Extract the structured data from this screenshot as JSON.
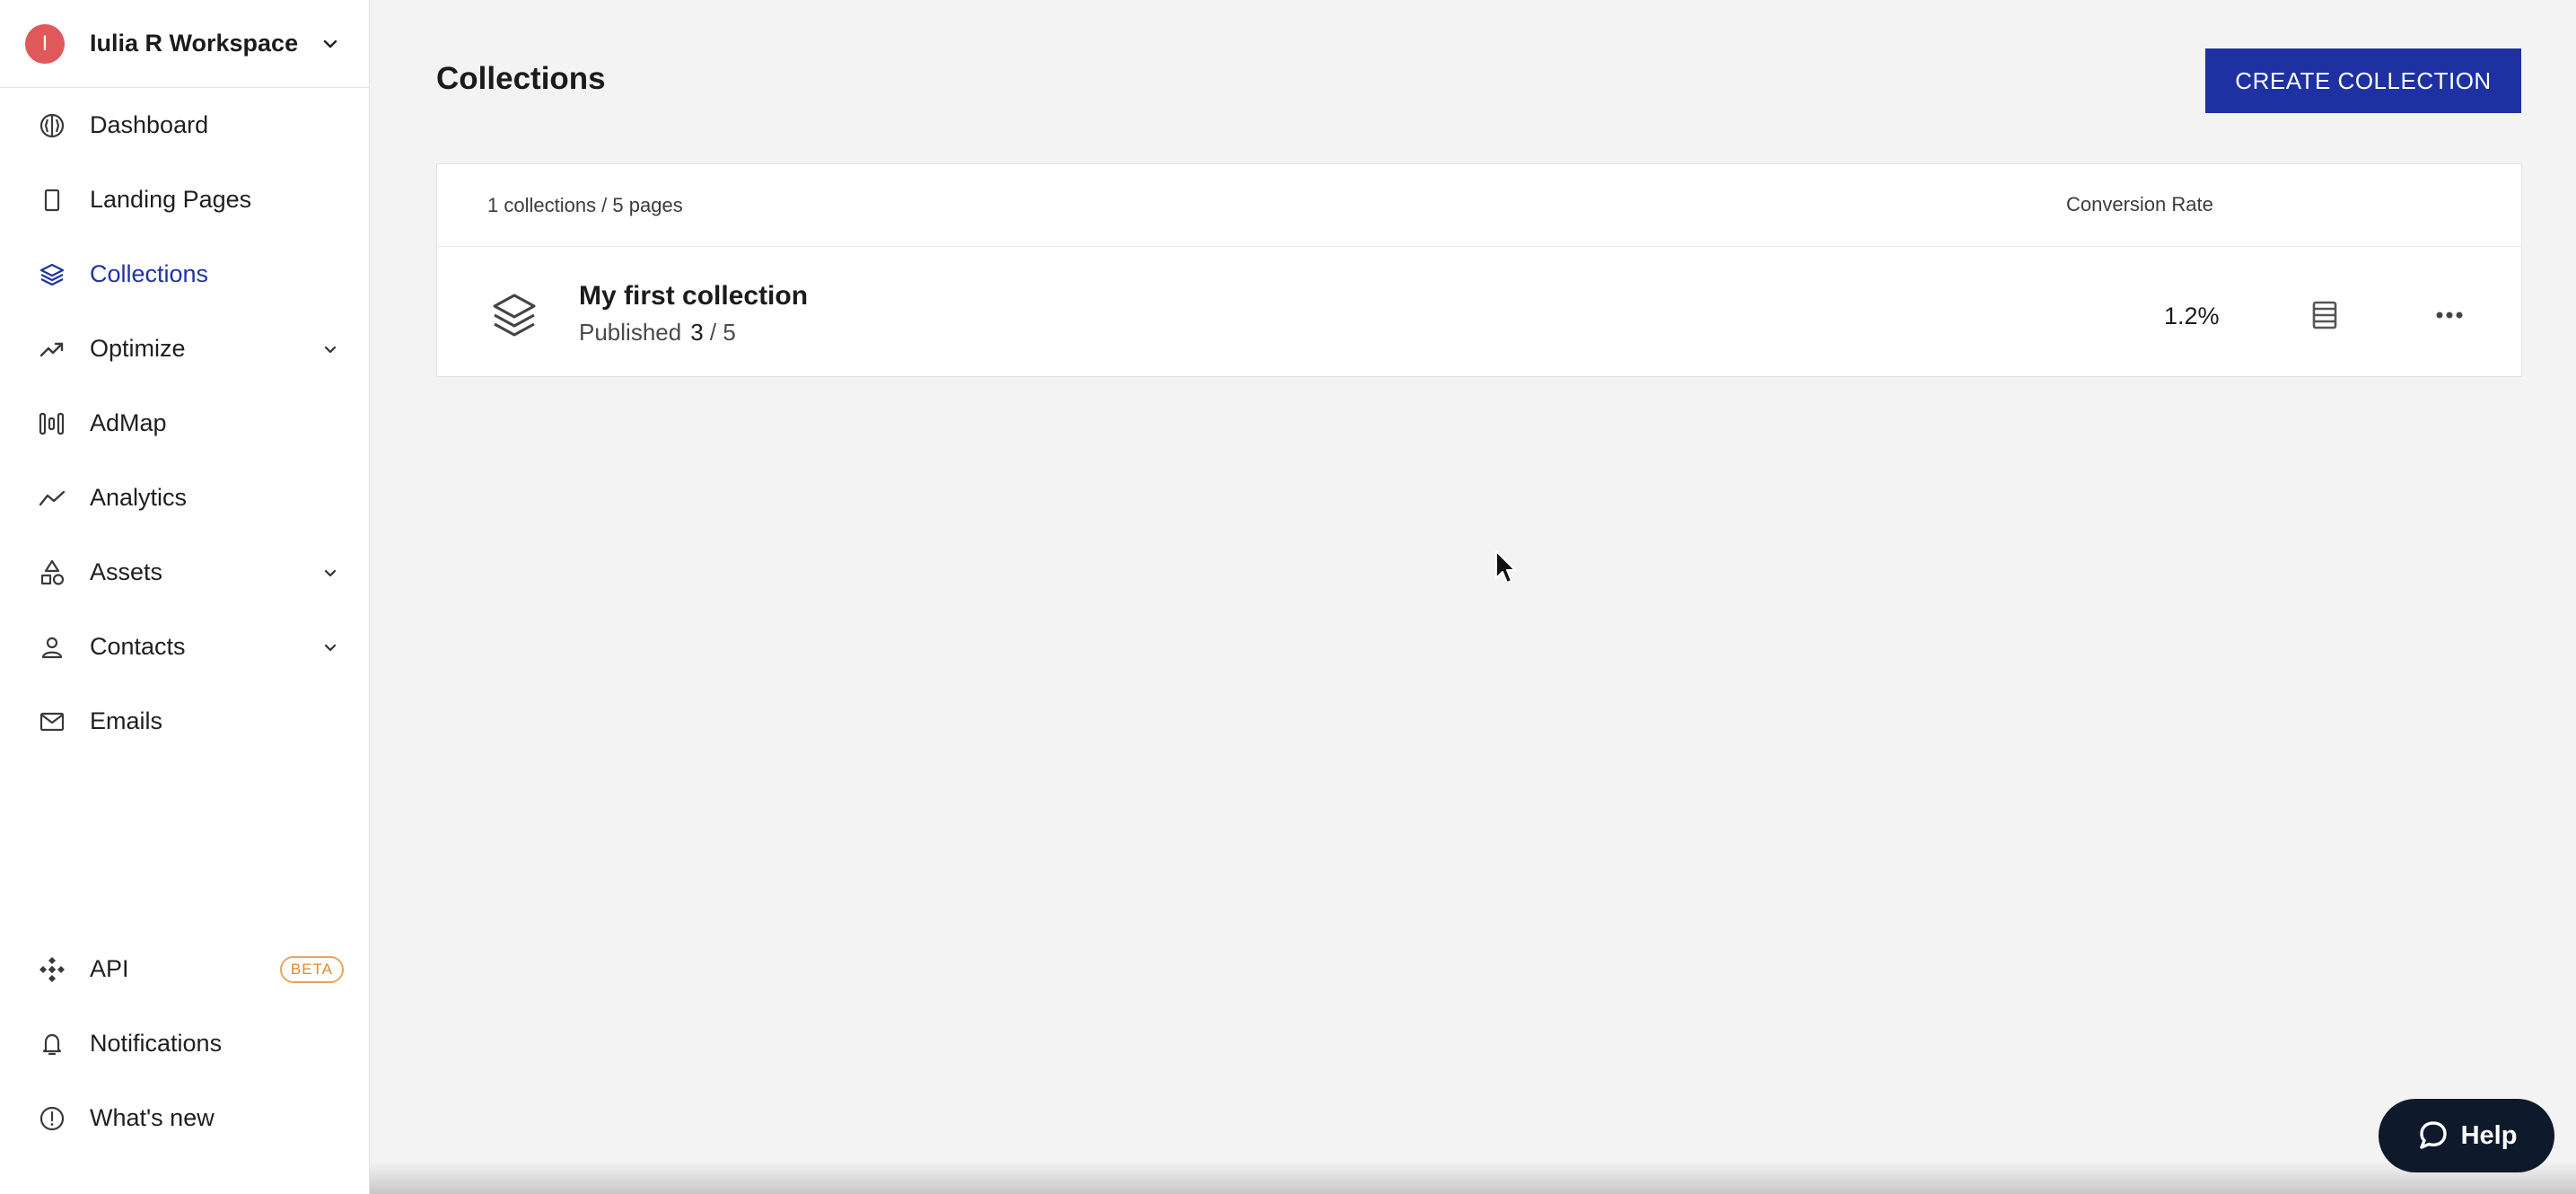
{
  "workspace": {
    "initial": "I",
    "name": "Iulia R Workspace",
    "avatar_color": "#e0585a"
  },
  "nav": {
    "dashboard": "Dashboard",
    "landing_pages": "Landing Pages",
    "collections": "Collections",
    "optimize": "Optimize",
    "admap": "AdMap",
    "analytics": "Analytics",
    "assets": "Assets",
    "contacts": "Contacts",
    "emails": "Emails"
  },
  "nav_bottom": {
    "api": "API",
    "api_badge": "BETA",
    "notifications": "Notifications",
    "whats_new": "What's new"
  },
  "page": {
    "title": "Collections",
    "create_button": "CREATE COLLECTION"
  },
  "table": {
    "summary": "1 collections / 5 pages",
    "col_conversion": "Conversion Rate",
    "rows": [
      {
        "title": "My first collection",
        "status_label": "Published",
        "published": "3",
        "total": "/ 5",
        "conversion_rate": "1.2%"
      }
    ]
  },
  "help": {
    "label": "Help"
  },
  "colors": {
    "accent": "#1e31a3",
    "active_nav": "#1f33a3",
    "help_bg": "#0e1a2b",
    "beta": "#e0892a"
  }
}
